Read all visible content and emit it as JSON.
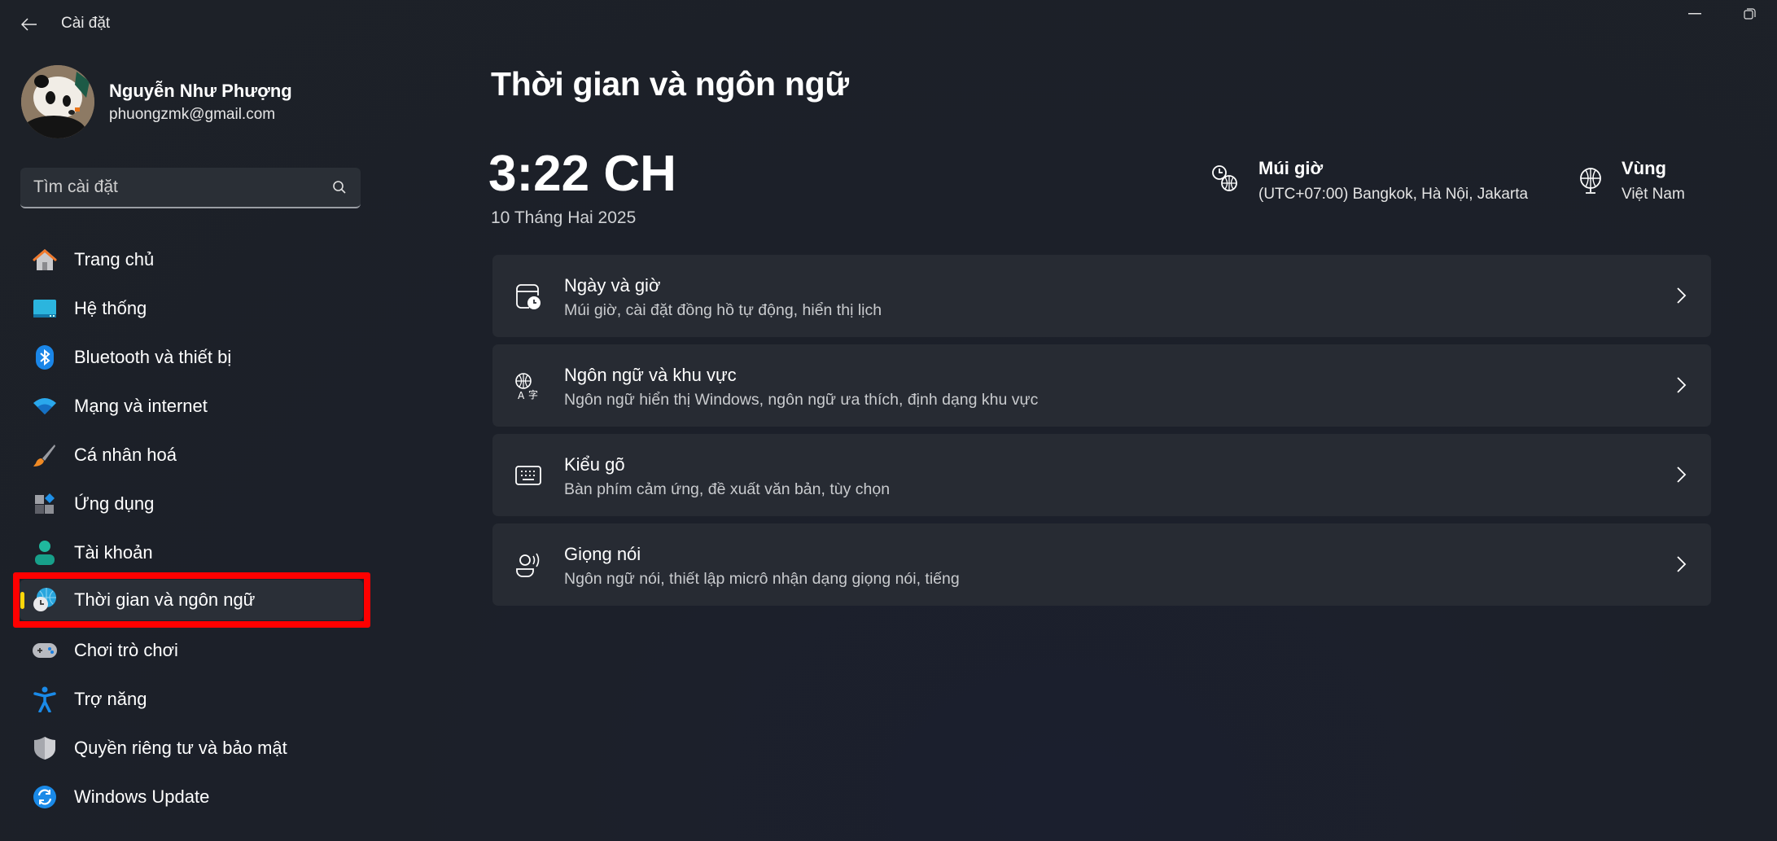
{
  "window": {
    "title": "Cài đặt",
    "back_icon": "arrow-left-icon",
    "minimize_icon": "minimize-icon",
    "restore_icon": "restore-icon"
  },
  "profile": {
    "name": "Nguyễn Như Phượng",
    "email": "phuongzmk@gmail.com",
    "avatar": "panda-avatar"
  },
  "search": {
    "placeholder": "Tìm cài đặt",
    "value": "",
    "icon": "search-icon"
  },
  "sidebar": {
    "items": [
      {
        "label": "Trang chủ",
        "icon": "home-icon",
        "active": false
      },
      {
        "label": "Hệ thống",
        "icon": "system-display-icon",
        "active": false
      },
      {
        "label": "Bluetooth và thiết bị",
        "icon": "bluetooth-icon",
        "active": false
      },
      {
        "label": "Mạng và internet",
        "icon": "wifi-icon",
        "active": false
      },
      {
        "label": "Cá nhân hoá",
        "icon": "paintbrush-icon",
        "active": false
      },
      {
        "label": "Ứng dụng",
        "icon": "apps-icon",
        "active": false
      },
      {
        "label": "Tài khoản",
        "icon": "account-icon",
        "active": false
      },
      {
        "label": "Thời gian và ngôn ngữ",
        "icon": "time-language-icon",
        "active": true
      },
      {
        "label": "Chơi trò chơi",
        "icon": "gamepad-icon",
        "active": false
      },
      {
        "label": "Trợ năng",
        "icon": "accessibility-icon",
        "active": false
      },
      {
        "label": "Quyền riêng tư và bảo mật",
        "icon": "shield-icon",
        "active": false
      },
      {
        "label": "Windows Update",
        "icon": "windows-update-icon",
        "active": false
      }
    ],
    "highlight_color": "#ff0000",
    "indicator_color": "#ffd60a"
  },
  "main": {
    "title": "Thời gian và ngôn ngữ",
    "time": "3:22 CH",
    "date": "10 Tháng Hai 2025",
    "timezone": {
      "label": "Múi giờ",
      "value": "(UTC+07:00) Bangkok, Hà Nội, Jakarta",
      "icon": "clock-globe-icon"
    },
    "region": {
      "label": "Vùng",
      "value": "Việt Nam",
      "icon": "globe-icon"
    },
    "cards": [
      {
        "title": "Ngày và giờ",
        "subtitle": "Múi giờ, cài đặt đồng hồ tự động, hiển thị lịch",
        "icon": "calendar-clock-icon"
      },
      {
        "title": "Ngôn ngữ và khu vực",
        "subtitle": "Ngôn ngữ hiển thị Windows, ngôn ngữ ưa thích, định dạng khu vực",
        "icon": "language-icon"
      },
      {
        "title": "Kiểu gõ",
        "subtitle": "Bàn phím cảm ứng, đề xuất văn bản, tùy chọn",
        "icon": "keyboard-icon"
      },
      {
        "title": "Giọng nói",
        "subtitle": "Ngôn ngữ nói, thiết lập micrô nhận dạng giọng nói, tiếng",
        "icon": "speech-icon"
      }
    ]
  }
}
